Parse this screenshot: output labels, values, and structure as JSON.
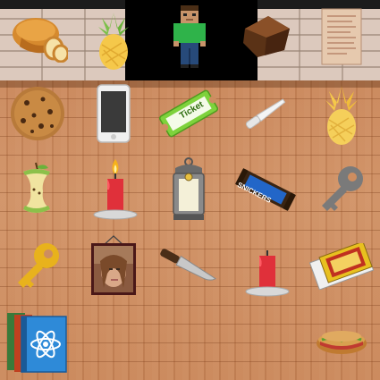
{
  "scene": {
    "items": [
      {
        "name": "bread-loaf"
      },
      {
        "name": "pineapple"
      },
      {
        "name": "player-character"
      },
      {
        "name": "chocolate"
      },
      {
        "name": "paper-note"
      },
      {
        "name": "cookie"
      },
      {
        "name": "smartphone"
      },
      {
        "name": "ticket",
        "label": "Ticket"
      },
      {
        "name": "knife-white"
      },
      {
        "name": "pineapple"
      },
      {
        "name": "apple-core"
      },
      {
        "name": "lit-candle"
      },
      {
        "name": "lantern"
      },
      {
        "name": "candy-bar",
        "label": "SNICKERS"
      },
      {
        "name": "grey-key"
      },
      {
        "name": "gold-key"
      },
      {
        "name": "framed-portrait"
      },
      {
        "name": "kitchen-knife"
      },
      {
        "name": "unlit-candle"
      },
      {
        "name": "matchbox"
      },
      {
        "name": "books-stack"
      },
      {
        "name": "sandwich"
      }
    ]
  },
  "colors": {
    "floor": "#cd8d60",
    "wall": "#dcc9bd",
    "doorway": "#000000",
    "ticket": "#7ed23c",
    "pineapple": "#f5cf5a",
    "candle": "#e0303a",
    "key_gold": "#e8b21c",
    "key_grey": "#7a7a7a"
  }
}
